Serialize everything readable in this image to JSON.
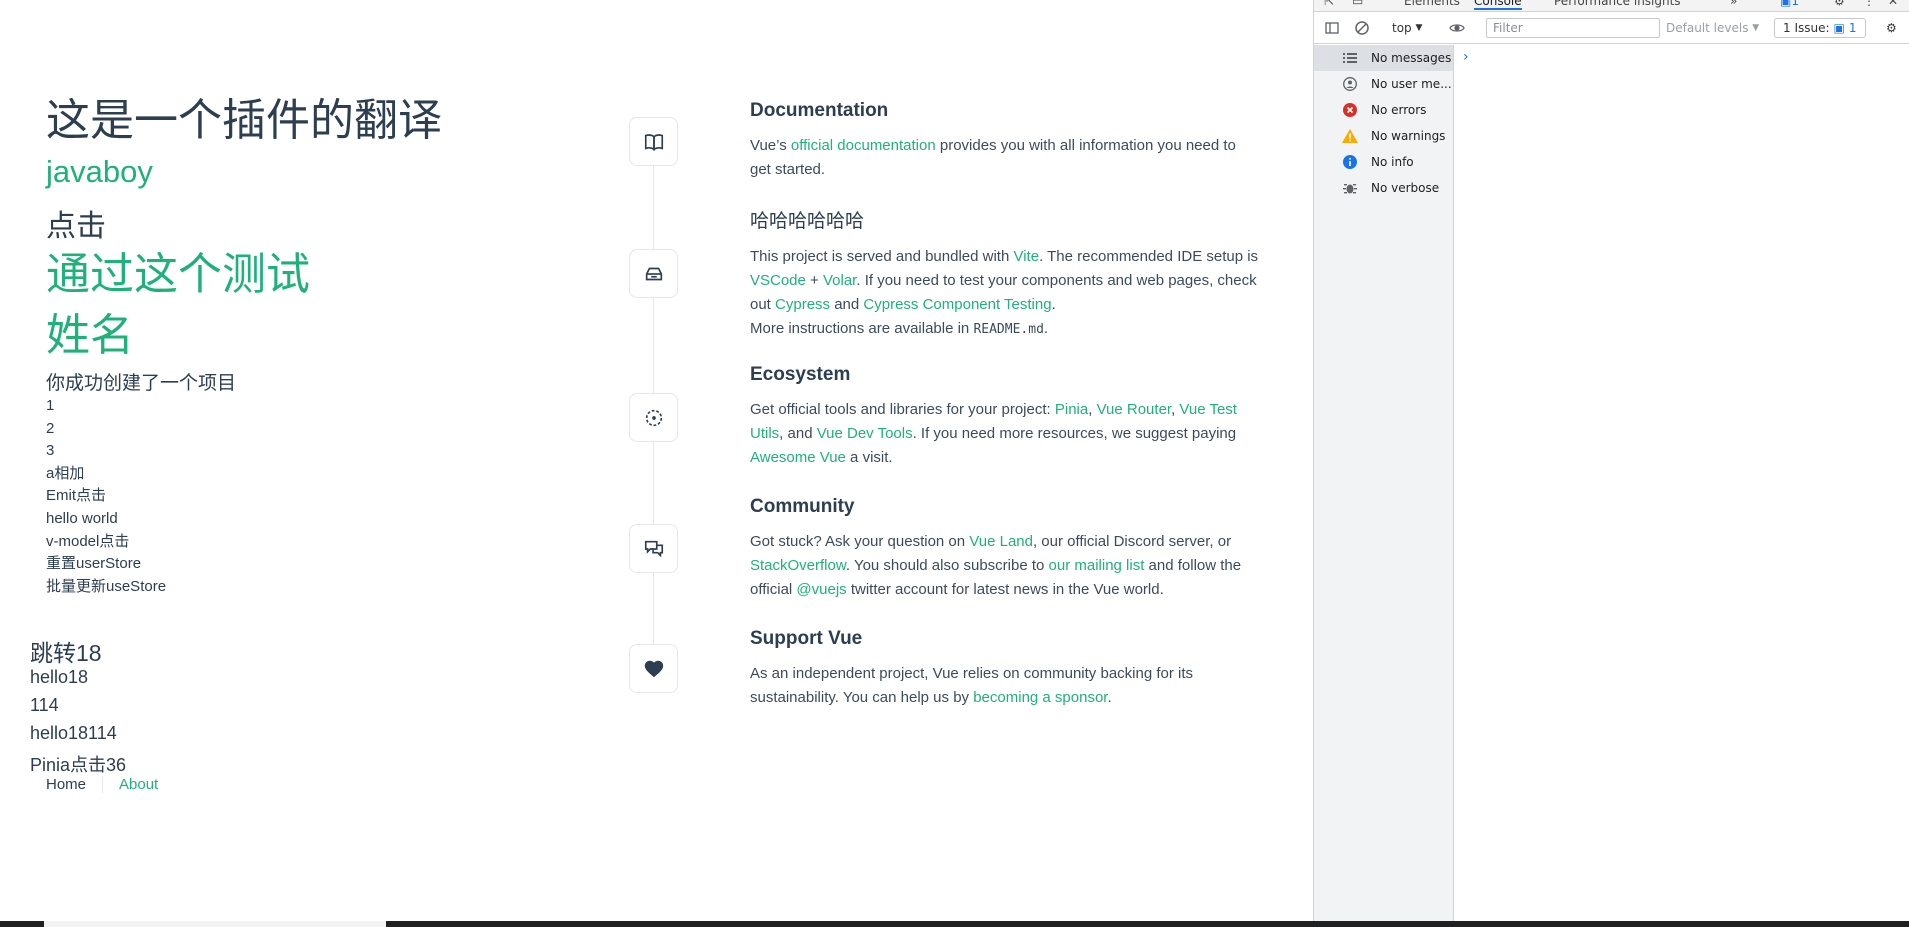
{
  "app": {
    "heading_cn": "这是一个插件的翻译",
    "javaboy": "javaboy",
    "click_label": "点击",
    "pass_test": "通过这个测试",
    "name_label": "姓名",
    "success_msg": "你成功创建了一个项目",
    "items": [
      "1",
      "2",
      "3",
      "a相加",
      "Emit点击",
      "hello world",
      "v-model点击",
      "重置userStore",
      "批量更新useStore"
    ],
    "jump": "跳转18",
    "hello18": "hello18",
    "n114": "114",
    "hello18114": "hello18114",
    "pinia_click": "Pinia点击36",
    "nav": {
      "home": "Home",
      "about": "About"
    }
  },
  "sections": {
    "documentation": {
      "title": "Documentation",
      "t1": "Vue’s ",
      "l1": "official documentation",
      "t2": " provides you with all information you need to get started."
    },
    "tooling": {
      "title": "哈哈哈哈哈哈",
      "t1": "This project is served and bundled with ",
      "l1": "Vite",
      "t2": ". The recommended IDE setup is ",
      "l2": "VSCode",
      "t3": " + ",
      "l3": "Volar",
      "t4": ". If you need to test your components and web pages, check out ",
      "l4": "Cypress",
      "t5": " and ",
      "l5": "Cypress Component Testing",
      "t6": ".",
      "t7": "More instructions are available in ",
      "code": "README.md",
      "t8": "."
    },
    "ecosystem": {
      "title": "Ecosystem",
      "t1": "Get official tools and libraries for your project: ",
      "l1": "Pinia",
      "t2": ", ",
      "l2": "Vue Router",
      "t3": ", ",
      "l3": "Vue Test Utils",
      "t4": ", and ",
      "l4": "Vue Dev Tools",
      "t5": ". If you need more resources, we suggest paying ",
      "l5": "Awesome Vue",
      "t6": " a visit."
    },
    "community": {
      "title": "Community",
      "t1": "Got stuck? Ask your question on ",
      "l1": "Vue Land",
      "t2": ", our official Discord server, or ",
      "l2": "StackOverflow",
      "t3": ". You should also subscribe to ",
      "l3": "our mailing list",
      "t4": " and follow the official ",
      "l4": "@vuejs",
      "t5": " twitter account for latest news in the Vue world."
    },
    "support": {
      "title": "Support Vue",
      "t1": "As an independent project, Vue relies on community backing for its sustainability. You can help us by ",
      "l1": "becoming a sponsor",
      "t2": "."
    }
  },
  "devtools": {
    "tabs": [
      "Elements",
      "Console",
      "Performance insights"
    ],
    "active_tab": "Console",
    "context": "top",
    "filter_placeholder": "Filter",
    "levels": "Default levels",
    "issues_label": "1 Issue:",
    "issues_count": "1",
    "sidebar": [
      {
        "label": "No messages",
        "icon": "list-icon"
      },
      {
        "label": "No user me...",
        "icon": "user-icon"
      },
      {
        "label": "No errors",
        "icon": "error-icon"
      },
      {
        "label": "No warnings",
        "icon": "warning-icon"
      },
      {
        "label": "No info",
        "icon": "info-icon"
      },
      {
        "label": "No verbose",
        "icon": "bug-icon"
      }
    ],
    "prompt": "›",
    "colors": {
      "accent": "#1a73e8",
      "error": "#d93025",
      "warning": "#f9ab00",
      "info": "#1a73e8"
    }
  }
}
